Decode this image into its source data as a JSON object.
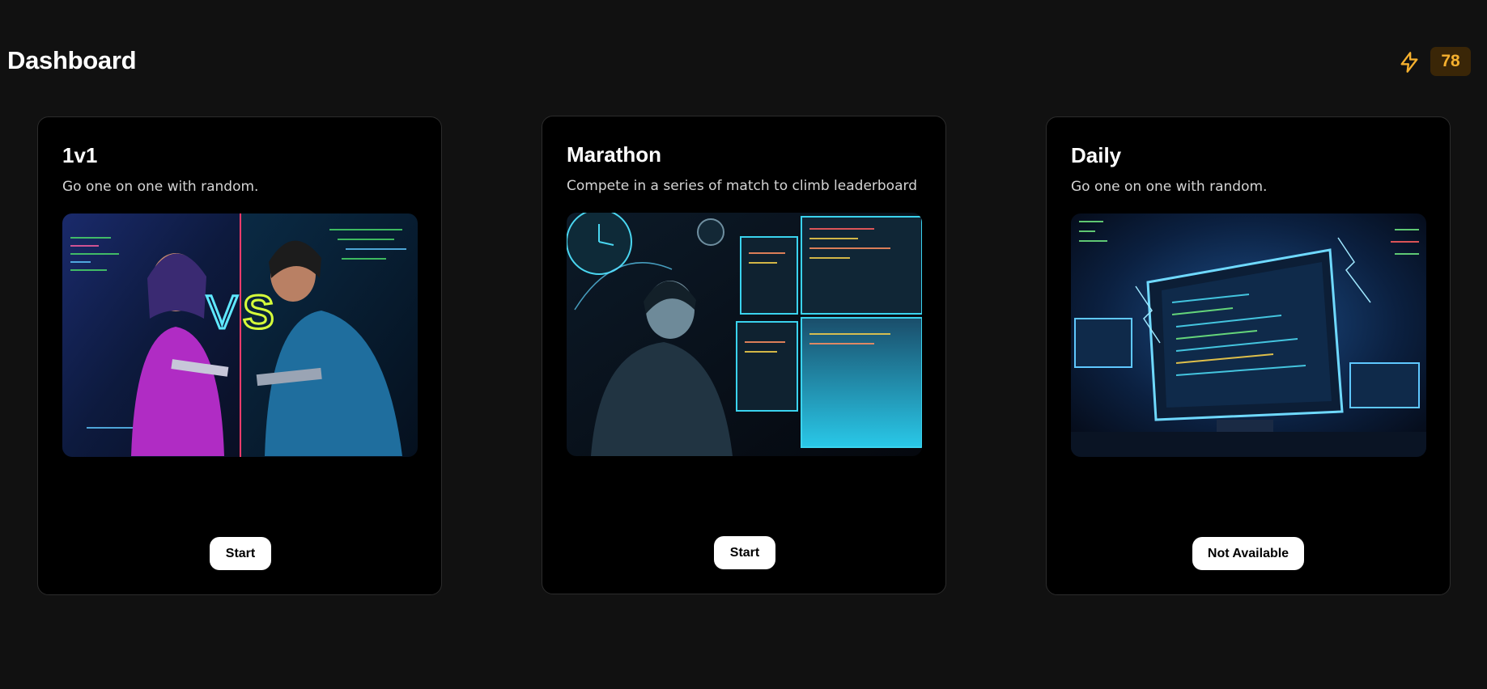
{
  "header": {
    "title": "Dashboard",
    "energy_icon": "lightning-bolt-icon",
    "energy_count": "78",
    "accent_color": "#f5b02e"
  },
  "cards": [
    {
      "title": "1v1",
      "description": "Go one on one with random.",
      "image": "two-coders-versus-image",
      "image_overlay_text": "VS",
      "button_label": "Start"
    },
    {
      "title": "Marathon",
      "description": "Compete in a series of match to climb leaderboard",
      "image": "coder-at-multiple-monitors-image",
      "image_overlay_text": "",
      "button_label": "Start"
    },
    {
      "title": "Daily",
      "description": "Go one on one with random.",
      "image": "glowing-monitor-code-image",
      "image_overlay_text": "",
      "button_label": "Not Available"
    }
  ]
}
